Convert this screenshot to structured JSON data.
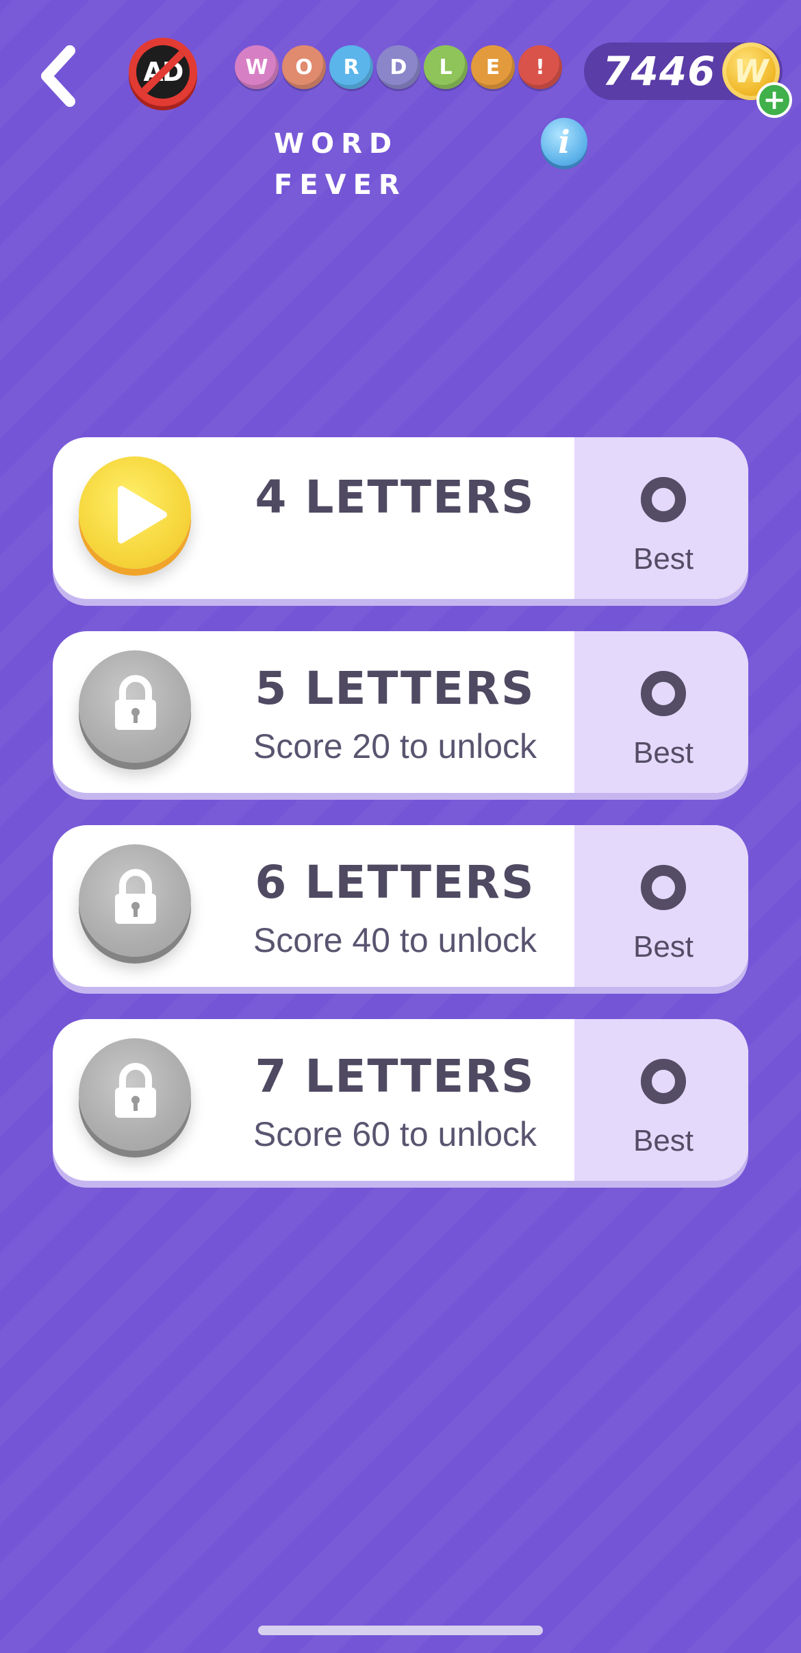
{
  "header": {
    "back_icon": "chevron-left-icon",
    "no_ads_label": "AD",
    "logo_letters": [
      {
        "char": "W",
        "color": "#d77fc4"
      },
      {
        "char": "O",
        "color": "#e08a6e"
      },
      {
        "char": "R",
        "color": "#5bb5ea"
      },
      {
        "char": "D",
        "color": "#8b86c9"
      },
      {
        "char": "L",
        "color": "#8ec45a"
      },
      {
        "char": "E",
        "color": "#e39a3c"
      },
      {
        "char": "!",
        "color": "#d9534a"
      }
    ],
    "coins": "7446",
    "coin_symbol": "W",
    "add_coins_label": "+",
    "mode_title": "WORD FEVER",
    "info_label": "i"
  },
  "levels": [
    {
      "title": "4 LETTERS",
      "unlock_text": "",
      "state": "play",
      "best_value": "0",
      "best_label": "Best"
    },
    {
      "title": "5 LETTERS",
      "unlock_text": "Score 20 to unlock",
      "state": "locked",
      "best_value": "0",
      "best_label": "Best"
    },
    {
      "title": "6 LETTERS",
      "unlock_text": "Score 40 to unlock",
      "state": "locked",
      "best_value": "0",
      "best_label": "Best"
    },
    {
      "title": "7 LETTERS",
      "unlock_text": "Score 60 to unlock",
      "state": "locked",
      "best_value": "0",
      "best_label": "Best"
    }
  ],
  "colors": {
    "background": "#7455d6",
    "card": "#ffffff",
    "best_panel": "#e4d9fb",
    "play_button": "#f6d63c",
    "lock_button": "#adadad",
    "coin_pill": "#5a3da7"
  }
}
